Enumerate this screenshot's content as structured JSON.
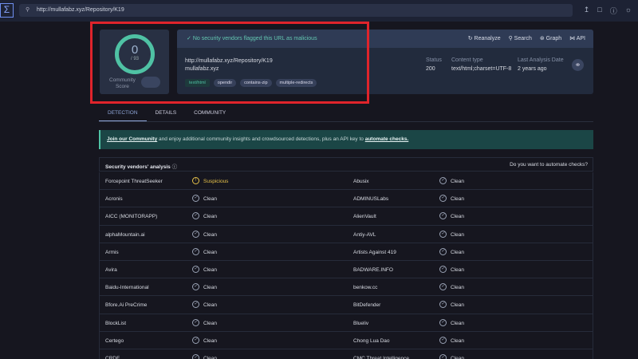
{
  "topbar": {
    "url": "http://mullafabz.xyz/Repository/K19"
  },
  "score": {
    "detections": "0",
    "total": "/ 93",
    "community_label_1": "Community",
    "community_label_2": "Score"
  },
  "summary": {
    "flag": "No security vendors flagged this URL as malicious",
    "actions": [
      "Reanalyze",
      "Search",
      "Graph",
      "API"
    ],
    "url": "http://mullafabz.xyz/Repository/K19",
    "domain": "mullafabz.xyz",
    "tags": [
      "text/html",
      "opendir",
      "contains-zip",
      "multiple-redirects"
    ],
    "status_label": "Status",
    "status": "200",
    "content_type_label": "Content type",
    "content_type": "text/html;charset=UTF-8",
    "date_label": "Last Analysis Date",
    "date": "2 years ago"
  },
  "tabs": [
    "DETECTION",
    "DETAILS",
    "COMMUNITY"
  ],
  "banner": {
    "link1": "Join our Community",
    "text": " and enjoy additional community insights and crowdsourced detections, plus an API key to ",
    "link2": "automate checks."
  },
  "vendors": {
    "title": "Security vendors' analysis",
    "automate": "Do you want to automate checks?",
    "rows": [
      [
        "Forcepoint ThreatSeeker",
        "Suspicious",
        "Abusix",
        "Clean"
      ],
      [
        "Acronis",
        "Clean",
        "ADMINUSLabs",
        "Clean"
      ],
      [
        "AICC (MONITORAPP)",
        "Clean",
        "AlienVault",
        "Clean"
      ],
      [
        "alphaMountain.ai",
        "Clean",
        "Antiy-AVL",
        "Clean"
      ],
      [
        "Armis",
        "Clean",
        "Artists Against 419",
        "Clean"
      ],
      [
        "Avira",
        "Clean",
        "BADWARE.INFO",
        "Clean"
      ],
      [
        "Baidu-International",
        "Clean",
        "benkow.cc",
        "Clean"
      ],
      [
        "Bfore.Ai PreCrime",
        "Clean",
        "BitDefender",
        "Clean"
      ],
      [
        "BlockList",
        "Clean",
        "Blueliv",
        "Clean"
      ],
      [
        "Certego",
        "Clean",
        "Chong Lua Dao",
        "Clean"
      ],
      [
        "CRDF",
        "Clean",
        "CMC Threat Intelligence",
        "Clean"
      ]
    ]
  }
}
